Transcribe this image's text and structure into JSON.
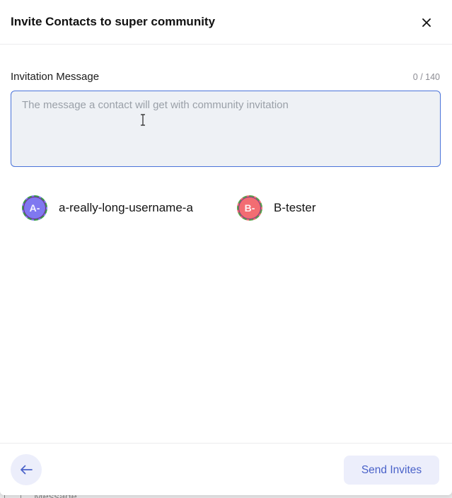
{
  "dialog": {
    "title": "Invite Contacts to super community",
    "close_icon": "close-icon"
  },
  "message": {
    "label": "Invitation Message",
    "counter": "0 / 140",
    "value": "",
    "placeholder": "The message a contact will get with community invitation"
  },
  "contacts": [
    {
      "initials": "A-",
      "name": "a-really-long-username-a",
      "avatar_color": "#7f78f0"
    },
    {
      "initials": "B-",
      "name": "B-tester",
      "avatar_color": "#f26d72"
    }
  ],
  "footer": {
    "back_icon": "arrow-left-icon",
    "send_label": "Send Invites"
  },
  "background": {
    "partial_label": "Message"
  },
  "colors": {
    "accent": "#4a62c9",
    "input_border": "#4a73d9",
    "button_bg": "#eceefb"
  }
}
